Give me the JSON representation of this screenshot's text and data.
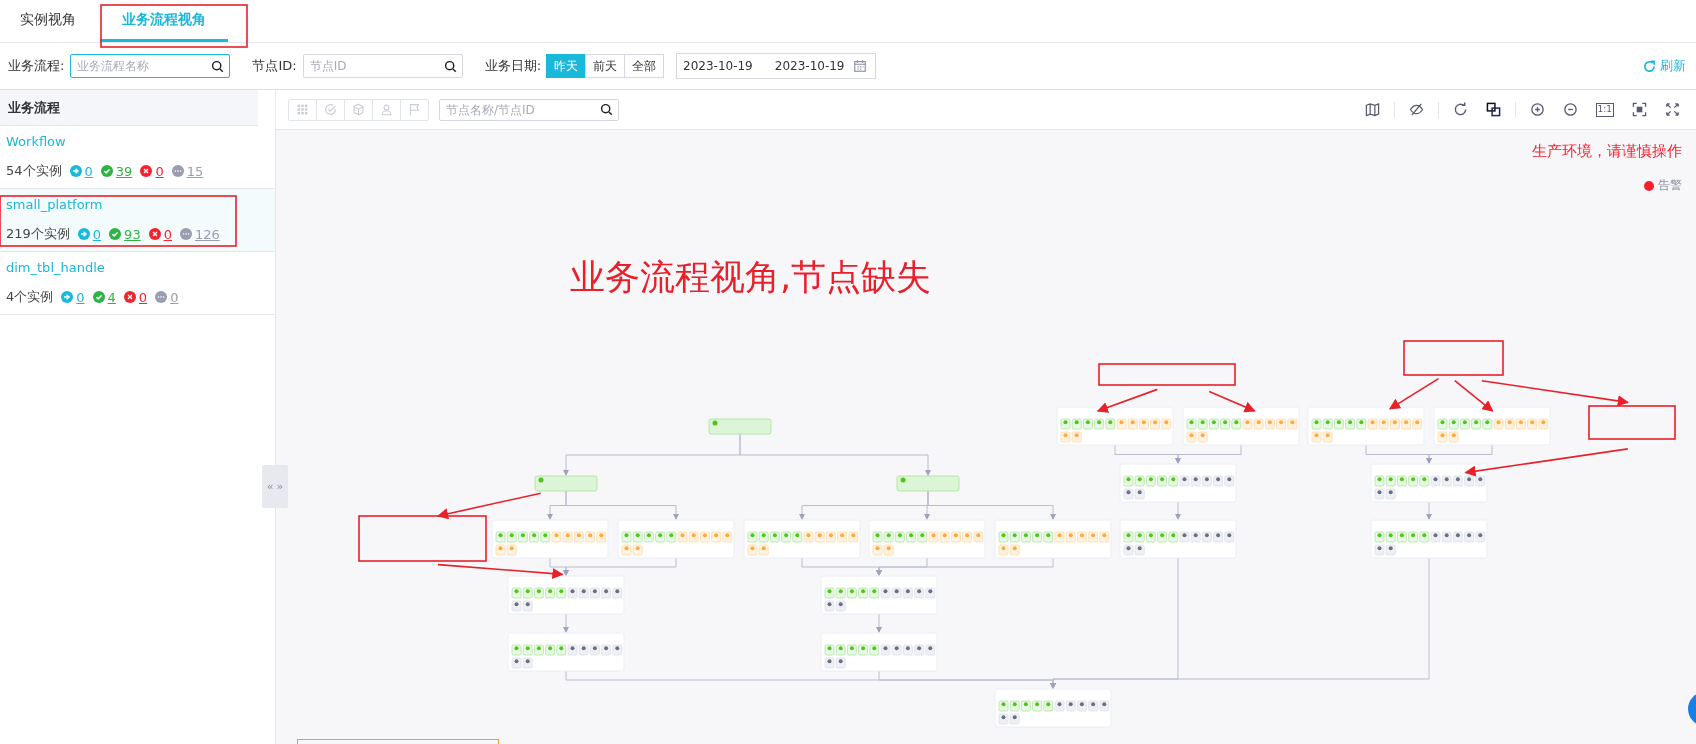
{
  "tabs": [
    {
      "label": "实例视角",
      "selected": false
    },
    {
      "label": "业务流程视角",
      "selected": true
    }
  ],
  "filters": {
    "flow_label": "业务流程:",
    "flow_placeholder": "业务流程名称",
    "node_label": "节点ID:",
    "node_placeholder": "节点ID",
    "date_label": "业务日期:",
    "date_options": [
      {
        "label": "昨天",
        "selected": true
      },
      {
        "label": "前天",
        "selected": false
      },
      {
        "label": "全部",
        "selected": false
      }
    ],
    "date_start": "2023-10-19",
    "date_end": "2023-10-19",
    "refresh": "刷新"
  },
  "sidebar": {
    "title": "业务流程",
    "items": [
      {
        "name": "Workflow",
        "instances": "54个实例",
        "selected": false,
        "stats": [
          {
            "kind": "running",
            "value": "0"
          },
          {
            "kind": "success",
            "value": "39"
          },
          {
            "kind": "failed",
            "value": "0"
          },
          {
            "kind": "other",
            "value": "15"
          }
        ]
      },
      {
        "name": "small_platform",
        "instances": "219个实例",
        "selected": true,
        "stats": [
          {
            "kind": "running",
            "value": "0"
          },
          {
            "kind": "success",
            "value": "93"
          },
          {
            "kind": "failed",
            "value": "0"
          },
          {
            "kind": "other",
            "value": "126"
          }
        ]
      },
      {
        "name": "dim_tbl_handle",
        "instances": "4个实例",
        "selected": false,
        "stats": [
          {
            "kind": "running",
            "value": "0"
          },
          {
            "kind": "success",
            "value": "4"
          },
          {
            "kind": "failed",
            "value": "0"
          },
          {
            "kind": "other",
            "value": "0"
          }
        ]
      }
    ],
    "collapse_handle": [
      "«",
      "»"
    ]
  },
  "toolbar": {
    "search_placeholder": "节点名称/节点ID",
    "actual_size_label": "1:1"
  },
  "canvas": {
    "warning": "生产环境，请谨慎操作",
    "legend": [
      {
        "label": "告警",
        "color": "#f5222d"
      }
    ],
    "annotation": "业务流程视角,节点缺失",
    "dag": {
      "nodes": [
        {
          "kind": "start"
        },
        {
          "kind": "start"
        },
        {
          "kind": "start"
        },
        {
          "kind": "task",
          "cells": [
            {
              "kind": "success"
            },
            {
              "kind": "success"
            },
            {
              "kind": "success"
            },
            {
              "kind": "success"
            },
            {
              "kind": "success"
            },
            {
              "kind": "waiting"
            },
            {
              "kind": "waiting"
            },
            {
              "kind": "waiting"
            },
            {
              "kind": "waiting"
            },
            {
              "kind": "waiting"
            },
            {
              "kind": "waiting"
            },
            {
              "kind": "waiting"
            }
          ]
        },
        {
          "kind": "task",
          "cells": [
            {
              "kind": "success"
            },
            {
              "kind": "success"
            },
            {
              "kind": "success"
            },
            {
              "kind": "success"
            },
            {
              "kind": "success"
            },
            {
              "kind": "waiting"
            },
            {
              "kind": "waiting"
            },
            {
              "kind": "waiting"
            },
            {
              "kind": "waiting"
            },
            {
              "kind": "waiting"
            },
            {
              "kind": "waiting"
            },
            {
              "kind": "waiting"
            }
          ]
        },
        {
          "kind": "task",
          "cells": [
            {
              "kind": "success"
            },
            {
              "kind": "success"
            },
            {
              "kind": "success"
            },
            {
              "kind": "success"
            },
            {
              "kind": "success"
            },
            {
              "kind": "waiting"
            },
            {
              "kind": "waiting"
            },
            {
              "kind": "waiting"
            },
            {
              "kind": "waiting"
            },
            {
              "kind": "waiting"
            },
            {
              "kind": "waiting"
            },
            {
              "kind": "waiting"
            }
          ]
        },
        {
          "kind": "task",
          "cells": [
            {
              "kind": "success"
            },
            {
              "kind": "success"
            },
            {
              "kind": "success"
            },
            {
              "kind": "success"
            },
            {
              "kind": "success"
            },
            {
              "kind": "waiting"
            },
            {
              "kind": "waiting"
            },
            {
              "kind": "waiting"
            },
            {
              "kind": "waiting"
            },
            {
              "kind": "waiting"
            },
            {
              "kind": "waiting"
            },
            {
              "kind": "waiting"
            }
          ]
        },
        {
          "kind": "task",
          "cells": [
            {
              "kind": "success"
            },
            {
              "kind": "success"
            },
            {
              "kind": "success"
            },
            {
              "kind": "success"
            },
            {
              "kind": "success"
            },
            {
              "kind": "waiting"
            },
            {
              "kind": "waiting"
            },
            {
              "kind": "waiting"
            },
            {
              "kind": "waiting"
            },
            {
              "kind": "waiting"
            },
            {
              "kind": "waiting"
            },
            {
              "kind": "waiting"
            }
          ]
        },
        {
          "kind": "task",
          "cells": [
            {
              "kind": "success"
            },
            {
              "kind": "success"
            },
            {
              "kind": "success"
            },
            {
              "kind": "success"
            },
            {
              "kind": "success"
            },
            {
              "kind": "idle"
            },
            {
              "kind": "idle"
            },
            {
              "kind": "idle"
            },
            {
              "kind": "idle"
            },
            {
              "kind": "idle"
            },
            {
              "kind": "idle"
            },
            {
              "kind": "idle"
            }
          ]
        },
        {
          "kind": "task",
          "cells": [
            {
              "kind": "success"
            },
            {
              "kind": "success"
            },
            {
              "kind": "success"
            },
            {
              "kind": "success"
            },
            {
              "kind": "success"
            },
            {
              "kind": "idle"
            },
            {
              "kind": "idle"
            },
            {
              "kind": "idle"
            },
            {
              "kind": "idle"
            },
            {
              "kind": "idle"
            },
            {
              "kind": "idle"
            },
            {
              "kind": "idle"
            }
          ]
        },
        {
          "kind": "task",
          "cells": [
            {
              "kind": "success"
            },
            {
              "kind": "success"
            },
            {
              "kind": "success"
            },
            {
              "kind": "success"
            },
            {
              "kind": "success"
            },
            {
              "kind": "idle"
            },
            {
              "kind": "idle"
            },
            {
              "kind": "idle"
            },
            {
              "kind": "idle"
            },
            {
              "kind": "idle"
            },
            {
              "kind": "idle"
            },
            {
              "kind": "idle"
            }
          ]
        },
        {
          "kind": "task",
          "cells": [
            {
              "kind": "success"
            },
            {
              "kind": "success"
            },
            {
              "kind": "success"
            },
            {
              "kind": "success"
            },
            {
              "kind": "success"
            },
            {
              "kind": "idle"
            },
            {
              "kind": "idle"
            },
            {
              "kind": "idle"
            },
            {
              "kind": "idle"
            },
            {
              "kind": "idle"
            },
            {
              "kind": "idle"
            },
            {
              "kind": "idle"
            }
          ]
        },
        {
          "kind": "task",
          "cells": [
            {
              "kind": "success"
            },
            {
              "kind": "success"
            },
            {
              "kind": "success"
            },
            {
              "kind": "success"
            },
            {
              "kind": "success"
            },
            {
              "kind": "idle"
            },
            {
              "kind": "idle"
            },
            {
              "kind": "idle"
            },
            {
              "kind": "idle"
            },
            {
              "kind": "idle"
            },
            {
              "kind": "idle"
            },
            {
              "kind": "idle"
            }
          ]
        },
        {
          "kind": "task",
          "cells": [
            {
              "kind": "success"
            },
            {
              "kind": "success"
            },
            {
              "kind": "success"
            },
            {
              "kind": "success"
            },
            {
              "kind": "success"
            },
            {
              "kind": "waiting"
            },
            {
              "kind": "waiting"
            },
            {
              "kind": "waiting"
            },
            {
              "kind": "waiting"
            },
            {
              "kind": "waiting"
            },
            {
              "kind": "waiting"
            },
            {
              "kind": "waiting"
            }
          ]
        },
        {
          "kind": "task",
          "cells": [
            {
              "kind": "success"
            },
            {
              "kind": "success"
            },
            {
              "kind": "success"
            },
            {
              "kind": "success"
            },
            {
              "kind": "success"
            },
            {
              "kind": "waiting"
            },
            {
              "kind": "waiting"
            },
            {
              "kind": "waiting"
            },
            {
              "kind": "waiting"
            },
            {
              "kind": "waiting"
            },
            {
              "kind": "waiting"
            },
            {
              "kind": "waiting"
            }
          ]
        },
        {
          "kind": "task",
          "cells": [
            {
              "kind": "success"
            },
            {
              "kind": "success"
            },
            {
              "kind": "success"
            },
            {
              "kind": "success"
            },
            {
              "kind": "success"
            },
            {
              "kind": "waiting"
            },
            {
              "kind": "waiting"
            },
            {
              "kind": "waiting"
            },
            {
              "kind": "waiting"
            },
            {
              "kind": "waiting"
            },
            {
              "kind": "waiting"
            },
            {
              "kind": "waiting"
            }
          ]
        },
        {
          "kind": "task",
          "cells": [
            {
              "kind": "success"
            },
            {
              "kind": "success"
            },
            {
              "kind": "success"
            },
            {
              "kind": "success"
            },
            {
              "kind": "success"
            },
            {
              "kind": "waiting"
            },
            {
              "kind": "waiting"
            },
            {
              "kind": "waiting"
            },
            {
              "kind": "waiting"
            },
            {
              "kind": "waiting"
            },
            {
              "kind": "waiting"
            },
            {
              "kind": "waiting"
            }
          ]
        },
        {
          "kind": "task",
          "cells": [
            {
              "kind": "success"
            },
            {
              "kind": "success"
            },
            {
              "kind": "success"
            },
            {
              "kind": "success"
            },
            {
              "kind": "success"
            },
            {
              "kind": "idle"
            },
            {
              "kind": "idle"
            },
            {
              "kind": "idle"
            },
            {
              "kind": "idle"
            },
            {
              "kind": "idle"
            },
            {
              "kind": "idle"
            },
            {
              "kind": "idle"
            }
          ]
        },
        {
          "kind": "task",
          "cells": [
            {
              "kind": "success"
            },
            {
              "kind": "success"
            },
            {
              "kind": "success"
            },
            {
              "kind": "success"
            },
            {
              "kind": "success"
            },
            {
              "kind": "idle"
            },
            {
              "kind": "idle"
            },
            {
              "kind": "idle"
            },
            {
              "kind": "idle"
            },
            {
              "kind": "idle"
            },
            {
              "kind": "idle"
            },
            {
              "kind": "idle"
            }
          ]
        },
        {
          "kind": "task",
          "cells": [
            {
              "kind": "success"
            },
            {
              "kind": "success"
            },
            {
              "kind": "success"
            },
            {
              "kind": "success"
            },
            {
              "kind": "success"
            },
            {
              "kind": "idle"
            },
            {
              "kind": "idle"
            },
            {
              "kind": "idle"
            },
            {
              "kind": "idle"
            },
            {
              "kind": "idle"
            },
            {
              "kind": "idle"
            },
            {
              "kind": "idle"
            }
          ]
        },
        {
          "kind": "task",
          "cells": [
            {
              "kind": "success"
            },
            {
              "kind": "success"
            },
            {
              "kind": "success"
            },
            {
              "kind": "success"
            },
            {
              "kind": "success"
            },
            {
              "kind": "idle"
            },
            {
              "kind": "idle"
            },
            {
              "kind": "idle"
            },
            {
              "kind": "idle"
            },
            {
              "kind": "idle"
            },
            {
              "kind": "idle"
            },
            {
              "kind": "idle"
            }
          ]
        }
      ]
    }
  }
}
